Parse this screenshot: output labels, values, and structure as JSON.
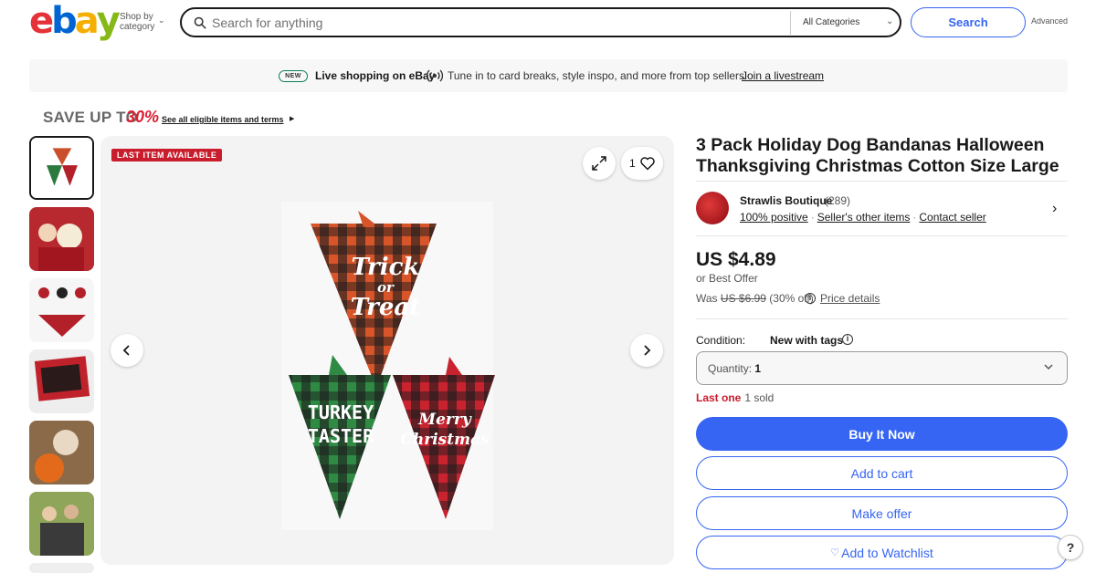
{
  "header": {
    "logo_letters": [
      "e",
      "b",
      "a",
      "y"
    ],
    "logo_colors": [
      "#e53238",
      "#0064d2",
      "#f5af02",
      "#86b817"
    ],
    "shop_by_line1": "Shop by",
    "shop_by_line2": "category",
    "search_placeholder": "Search for anything",
    "category_select": "All Categories",
    "search_button": "Search",
    "advanced_link": "Advanced"
  },
  "banner": {
    "badge": "NEW",
    "title": "Live shopping on eBay",
    "text": "Tune in to card breaks, style inspo, and more from top sellers.",
    "link": "Join a livestream"
  },
  "promo": {
    "text": "SAVE UP TO",
    "percent": "30%",
    "link": "See all eligible items and terms"
  },
  "gallery": {
    "badge": "LAST ITEM AVAILABLE",
    "watch_count": "1",
    "thumbnail_icons": [
      "bandana-thumb",
      "dog-kids-thumb",
      "bandana-sizes-thumb",
      "package-thumb",
      "dog-pumpkin-thumb",
      "family-dog-thumb"
    ],
    "bandanas": [
      {
        "line1": "Trick",
        "line2": "or",
        "line3": "Treat",
        "color": "orange-black-plaid"
      },
      {
        "line1": "TURKEY",
        "line2": "TASTER",
        "line3": "",
        "color": "green-black-plaid"
      },
      {
        "line1": "Merry",
        "line2": "Christmas",
        "line3": "",
        "color": "red-black-plaid"
      }
    ]
  },
  "listing": {
    "title": "3 Pack Holiday Dog Bandanas Halloween Thanksgiving Christmas Cotton Size Large",
    "seller": {
      "name": "Strawlis Boutique",
      "feedback_count": "(289)",
      "positive": "100% positive",
      "other_items": "Seller's other items",
      "contact": "Contact seller"
    },
    "price": "US $4.89",
    "best_offer": "or Best Offer",
    "was_label": "Was",
    "was_price": "US $6.99",
    "discount": "(30% off)",
    "price_details": "Price details",
    "condition_label": "Condition:",
    "condition_value": "New with tags",
    "quantity_label": "Quantity:",
    "quantity_value": "1",
    "last_one": "Last one",
    "sold": "· 1 sold",
    "buy_now": "Buy It Now",
    "add_to_cart": "Add to cart",
    "make_offer": "Make offer",
    "watchlist": "Add to Watchlist",
    "help": "?"
  },
  "colors": {
    "primary_blue": "#3665f3",
    "alert_red": "#c91c2c"
  }
}
